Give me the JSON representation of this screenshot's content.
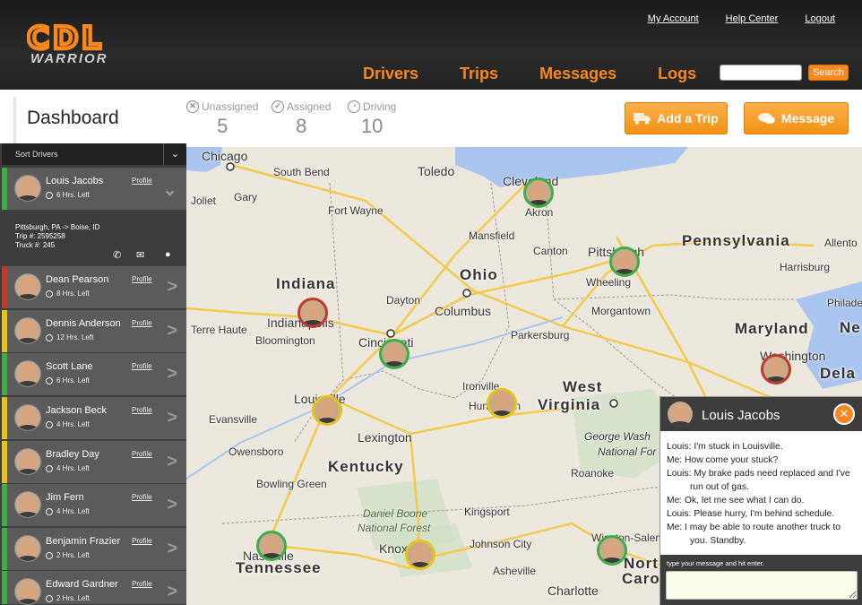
{
  "logo": {
    "main": "CDL",
    "sub": "WARRIOR"
  },
  "util_links": [
    "My Account",
    "Help Center",
    "Logout"
  ],
  "nav": [
    "Drivers",
    "Trips",
    "Messages",
    "Logs"
  ],
  "search": {
    "placeholder": "",
    "button": "Search"
  },
  "page_title": "Dashboard",
  "stats": [
    {
      "label": "Unassigned",
      "value": "5",
      "icon": "x-circle-icon"
    },
    {
      "label": "Assigned",
      "value": "8",
      "icon": "check-circle-icon"
    },
    {
      "label": "Driving",
      "value": "10",
      "icon": "steering-icon"
    }
  ],
  "actions": {
    "add_trip": "Add a Trip",
    "message": "Message"
  },
  "sidebar": {
    "sort_label": "Sort Drivers",
    "profile_label": "Profile",
    "expanded": {
      "route": "Pittsburgh, PA -> Boise, ID",
      "trip": "Trip #: 2595258",
      "truck": "Truck #: 245"
    },
    "drivers": [
      {
        "name": "Louis Jacobs",
        "hours": "6 Hrs. Left",
        "status": "#3bae48"
      },
      {
        "name": "Dean Pearson",
        "hours": "8 Hrs. Left",
        "status": "#c0392b"
      },
      {
        "name": "Dennis Anderson",
        "hours": "12 Hrs. Left",
        "status": "#e6c21a"
      },
      {
        "name": "Scott Lane",
        "hours": "6 Hrs. Left",
        "status": "#3bae48"
      },
      {
        "name": "Jackson Beck",
        "hours": "4 Hrs. Left",
        "status": "#e6c21a"
      },
      {
        "name": "Bradley Day",
        "hours": "4 Hrs. Left",
        "status": "#e6c21a"
      },
      {
        "name": "Jim Fern",
        "hours": "4 Hrs. Left",
        "status": "#3bae48"
      },
      {
        "name": "Benjamin Frazier",
        "hours": "2 Hrs. Left",
        "status": "#3bae48"
      },
      {
        "name": "Edward Gardner",
        "hours": "2 Hrs. Left",
        "status": "#3bae48"
      }
    ]
  },
  "map": {
    "states": [
      "Indiana",
      "Ohio",
      "Pennsylvania",
      "Maryland",
      "West",
      "Virginia",
      "Kentucky",
      "Tennessee",
      "Dela",
      "Ne",
      "Virgi",
      "Caroli",
      "Nort"
    ],
    "cities": [
      "Chicago",
      "South Bend",
      "Toledo",
      "Cleveland",
      "Akron",
      "Joliet",
      "Gary",
      "Fort Wayne",
      "Mansfield",
      "Canton",
      "Pittsburgh",
      "Allento",
      "Harrisburg",
      "Indianapolis",
      "Dayton",
      "Columbus",
      "Wheeling",
      "Philadelph",
      "Bloomington",
      "Cincinnati",
      "Morgantown",
      "Terre Haute",
      "Parkersburg",
      "Louisville",
      "Ironville",
      "Huntington",
      "Washington",
      "Evansville",
      "Lexington",
      "George Wash",
      "National For",
      "Owensboro",
      "Roanoke",
      "Bowling Green",
      "Kingsport",
      "Johnson City",
      "Winston-Salem",
      "Nashville",
      "Knoxville",
      "Asheville",
      "Charlotte"
    ],
    "parks": [
      "Daniel Boone",
      "National Forest"
    ]
  },
  "chat": {
    "name": "Louis Jacobs",
    "messages": [
      "Louis: I'm stuck in Louisville.",
      "Me: How come your stuck?",
      "Louis: My brake pads need replaced and I've run out of gas.",
      "Me: Ok, let me see what I can do.",
      "Louis: Please hurry, I'm behind schedule.",
      "Me: I may be able to route another truck to you. Standby."
    ],
    "hint": "type your message and hit enter."
  },
  "colors": {
    "accent": "#f7871f",
    "green": "#3bae48",
    "red": "#c0392b",
    "yellow": "#e6c21a"
  }
}
